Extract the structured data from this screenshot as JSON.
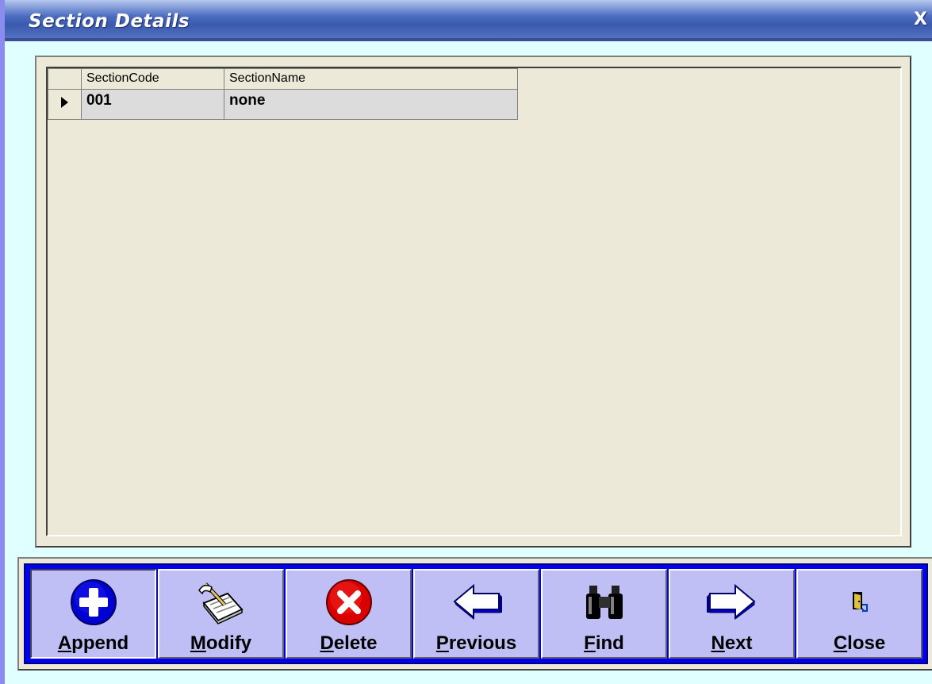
{
  "window": {
    "title": "Section Details",
    "close_label": "X"
  },
  "grid": {
    "columns": [
      "SectionCode",
      "SectionName"
    ],
    "rows": [
      {
        "SectionCode": "001",
        "SectionName": "none",
        "current": true
      }
    ]
  },
  "toolbar": {
    "buttons": [
      {
        "key": "A",
        "rest": "ppend",
        "label": "Append",
        "icon": "plus-circle-icon"
      },
      {
        "key": "M",
        "rest": "odify",
        "label": "Modify",
        "icon": "notepad-pencil-icon"
      },
      {
        "key": "D",
        "rest": "elete",
        "label": "Delete",
        "icon": "x-circle-icon"
      },
      {
        "key": "P",
        "rest": "revious",
        "label": "Previous",
        "icon": "left-arrow-icon"
      },
      {
        "key": "F",
        "rest": "ind",
        "label": "Find",
        "icon": "binoculars-icon"
      },
      {
        "key": "N",
        "rest": "ext",
        "label": "Next",
        "icon": "right-arrow-icon"
      },
      {
        "key": "C",
        "rest": "lose",
        "label": "Close",
        "icon": "door-exit-icon"
      }
    ]
  },
  "colors": {
    "title_bar": "#3a5aae",
    "window_bg": "#e0ffff",
    "toolbar_bg": "#0000f0",
    "button_face": "#bfbff5"
  }
}
